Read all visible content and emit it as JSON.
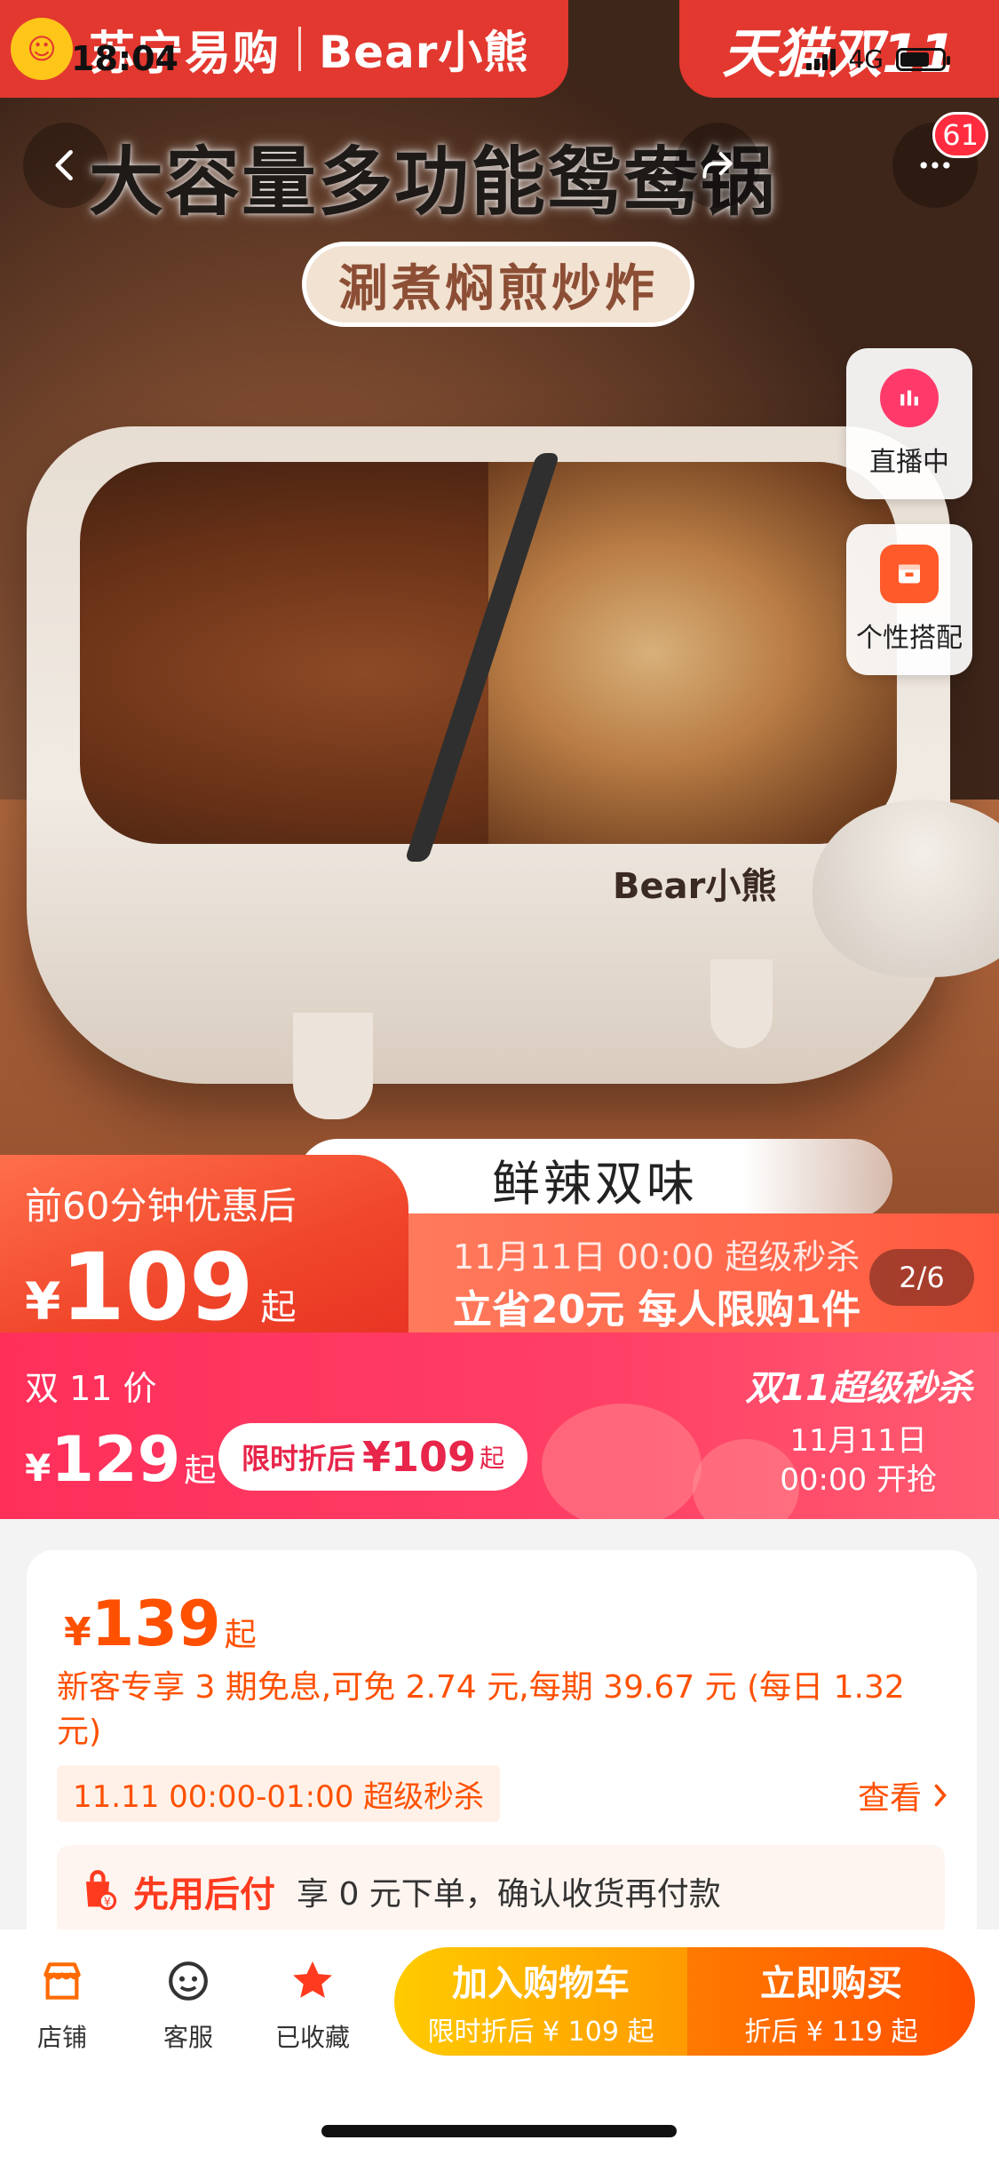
{
  "status": {
    "time": "18:04",
    "network": "4G"
  },
  "top_left_brand": {
    "store": "苏宁易购",
    "brand": "Bear小熊"
  },
  "top_right_brand": {
    "event": "天猫双11"
  },
  "cart_count": "61",
  "hero": {
    "headline": "大容量多功能鸳鸯锅",
    "sub_pill": "涮煮焖煎炒炸",
    "product_brand": "Bear小熊",
    "flavor": "鲜辣双味",
    "side_live": "直播中",
    "side_match": "个性搭配",
    "page_indicator": "2/6"
  },
  "promo": {
    "label": "前60分钟优惠后",
    "currency": "¥",
    "price": "109",
    "suffix": "起",
    "line1": "11月11日 00:00 超级秒杀",
    "line2": "立省20元 每人限购1件"
  },
  "double11": {
    "label": "双 11 价",
    "currency": "¥",
    "price": "129",
    "suffix": "起",
    "pill_prefix": "限时折后",
    "pill_currency": "¥",
    "pill_price": "109",
    "pill_suffix": "起",
    "right_title": "双11超级秒杀",
    "date_line1": "11月11日",
    "date_line2": "00:00 开抢"
  },
  "card": {
    "currency": "¥",
    "price": "139",
    "suffix": "起",
    "installment": "新客专享 3 期免息,可免 2.74 元,每期 39.67 元 (每日 1.32元)",
    "flash_tag": "11.11 00:00-01:00 超级秒杀",
    "view_label": "查看",
    "pay_later_title": "先用后付",
    "pay_later_desc": "享 0 元下单，确认收货再付款"
  },
  "bottom_bar": {
    "store": "店铺",
    "service": "客服",
    "favorited": "已收藏",
    "add_cart_main": "加入购物车",
    "add_cart_sub": "限时折后 ¥ 109 起",
    "buy_main": "立即购买",
    "buy_sub": "折后 ¥ 119 起"
  },
  "colors": {
    "accent_orange": "#ff5000",
    "tmall_red": "#e2382f",
    "d11_pink": "#ff2f5a"
  },
  "icons": [
    "back-icon",
    "share-icon",
    "more-icon",
    "live-icon",
    "match-icon",
    "store-icon",
    "service-icon",
    "star-icon",
    "paylater-icon",
    "chevron-right-icon"
  ]
}
